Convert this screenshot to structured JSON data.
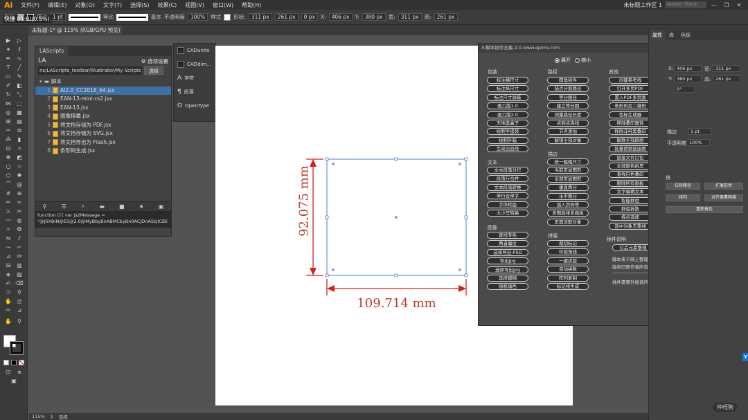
{
  "menubar": {
    "logo": "Ai",
    "items": [
      "文件(F)",
      "编辑(E)",
      "对象(O)",
      "文字(T)",
      "选择(S)",
      "效果(C)",
      "视图(V)",
      "窗口(W)",
      "帮助(H)"
    ],
    "workspace": "未标题工作区 1",
    "search_placeholder": "Adobe Stock",
    "window_buttons": [
      "—",
      "❐",
      "✕"
    ]
  },
  "controlbar": {
    "mode_label": "形状",
    "stroke_label": "描边",
    "stroke_weight": "1 pt",
    "stroke_style": "等比",
    "brush_style": "基本",
    "opacity_label": "不透明度",
    "opacity_value": "100%",
    "style_label": "样式",
    "shape_label": "形状:",
    "width_value": "311 px",
    "height_value": "261 px",
    "angle_value": "0 px",
    "x_label": "X:",
    "x_value": "406 px",
    "y_label": "Y:",
    "y_value": "380 px",
    "w_label": "宽:",
    "w_value": "311 px",
    "h_label": "高:",
    "h_value": "261 px"
  },
  "doc_tab": {
    "label": "未标题-1* @ 115% (RGB/GPU 预览)"
  },
  "overlay_text": "快捷  01:0/(0.5%)",
  "lascripts": {
    "tab": "LAScripts",
    "logo": "LA",
    "options_label": "选项设置",
    "path": "ns/LAScripts_toolbar/Illustrator/My Scripts",
    "select_button": "选择",
    "folder": "脚本",
    "files": [
      {
        "num": "1",
        "name": "AI2.0_CC2018_64.jsx",
        "selected": true
      },
      {
        "num": "2",
        "name": "EAN-13-mini-cs2.jsx",
        "selected": false
      },
      {
        "num": "3",
        "name": "EAN-13.jsx",
        "selected": false
      },
      {
        "num": "4",
        "name": "图像描摹.jsx",
        "selected": false
      },
      {
        "num": "5",
        "name": "将文档存储为 PDF.jsx",
        "selected": false
      },
      {
        "num": "6",
        "name": "将文档存储为 SVG.jsx",
        "selected": false
      },
      {
        "num": "7",
        "name": "将文档导出为 Flash.jsx",
        "selected": false
      },
      {
        "num": "8",
        "name": "条形码生成.jsx",
        "selected": false
      }
    ],
    "code_line1": "function (){ var js2Message =",
    "code_line2": "\"@JSXBIN@ES@2.0@MyBbyBnABMCbyBn0ACJDnASzJICiBi"
  },
  "small_panel": {
    "items": [
      "CADunits",
      "CADdim...",
      "字符",
      "段落",
      "OpenType"
    ]
  },
  "canvas": {
    "height_dim": "92.075 mm",
    "width_dim": "109.714 mm"
  },
  "plugin": {
    "title": "AI脚本插件合集-2.0-www.epimv.com",
    "expand": "展开",
    "collapse": "缩小",
    "sections": {
      "col1a": "包装",
      "col2a": "路径",
      "col3a": "其他",
      "col1b": "文本",
      "col2b": "描边",
      "col1c": "图像",
      "col2c": "拼版",
      "col3c": "插件说明"
    },
    "col1a_buttons": [
      "标注横尺寸",
      "标注纵尺寸",
      "标注尺寸屏蔽",
      "画刀版1.0",
      "画刀版2.0",
      "天地盖盒子",
      "绘制手提袋",
      "绘制外箱",
      "生成出血线"
    ],
    "col2a_buttons": [
      "圆角插件",
      "锚点分割路径",
      "等分路径",
      "建立等分圆",
      "测量路径长度",
      "点到点连线",
      "节点添加",
      "解锁全部对象"
    ],
    "col3a_buttons": [
      "创建参考线",
      "打开多页PDF",
      "置入PDF多页面",
      "条形码及二维码",
      "色标生成器",
      "移除叠印属性",
      "移除非纯黑叠印",
      "解散全部群组",
      "批量替换链接图",
      "链接文件打包",
      "全部颜色拆黑",
      "查找白色叠印",
      "删除所有画板",
      "文字编辑文本",
      "智能群组",
      "群组拆散",
      "描点选择",
      "选中对象去重线"
    ],
    "col1b_buttons": [
      "文本段落分行",
      "段落行合并",
      "文本段落转换",
      "单行合单字",
      "字体转曲",
      "大小写转换"
    ],
    "col2b_buttons": [
      "统一粗粗尺寸",
      "当前页加图形",
      "全部页加图形",
      "垂直两分",
      "水平两分",
      "插入页码等",
      "多图层排多画板",
      "页面适配对象"
    ],
    "col1c_buttons": [
      "查找专色",
      "两者偏位",
      "选择导出-PSD",
      "导出jpg",
      "选择导出jpg",
      "选择模糊",
      "随机填色"
    ],
    "col2c_buttons": [
      "裁切标记",
      "印前角线",
      "一键拼版",
      "自动拼数",
      "阵列复制",
      "标记线生成"
    ],
    "col3c_button": "亿品元素整理",
    "col3c_lines": [
      "脚本来于网上整理",
      "版权归原作者所有",
      "——————————",
      "插件需要升级询问"
    ]
  },
  "right_panel": {
    "tabs": [
      "属性",
      "库",
      "色板"
    ],
    "x_label": "X:",
    "x_value": "406 px",
    "y_label": "Y:",
    "y_value": "380 px",
    "w_label": "宽:",
    "w_value": "311 px",
    "h_label": "高:",
    "h_value": "261 px",
    "angle_value": "0°",
    "stroke_label": "描边",
    "stroke_value": "1 pt",
    "opacity_label": "不透明度",
    "opacity_value": "100%",
    "section_label": "快",
    "btn1": "位移路径",
    "btn2": "扩展形状",
    "btn3": "排列",
    "btn4": "对齐像素网格",
    "btn5": "重新着色",
    "badge": "Y"
  },
  "status": {
    "zoom": "115%",
    "page": "1",
    "mode": "选择"
  },
  "watermark": "仲旺狗"
}
